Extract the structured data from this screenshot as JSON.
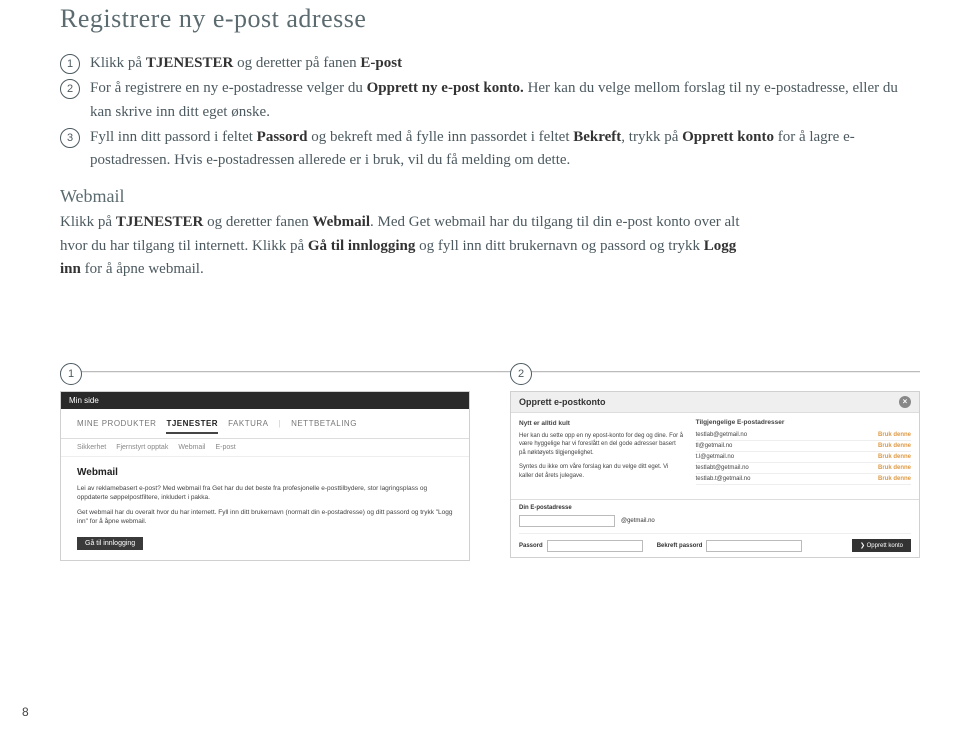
{
  "heading": "Registrere ny e-post adresse",
  "steps": [
    {
      "pre": "Klikk på ",
      "b1": "TJENESTER",
      "mid": " og deretter på fanen ",
      "b2": "E-post"
    },
    {
      "pre": "For å registrere en ny e-postadresse velger du ",
      "b1": "Opprett ny e-post konto.",
      "mid": " Her kan du velge mellom forslag til ny e-postadresse, eller du kan skrive inn ditt eget ønske."
    },
    {
      "pre": "Fyll inn ditt passord i feltet ",
      "b1": "Passord",
      "mid": " og bekreft med å fylle inn passordet i feltet ",
      "b2": "Bekreft",
      "mid2": ", trykk på ",
      "b3": "Opprett konto",
      "mid3": " for å lagre e-postadressen. Hvis e-postadressen allerede er i bruk, vil du få melding om dette."
    }
  ],
  "webmail": {
    "title": "Webmail",
    "p1a": "Klikk på ",
    "p1b": "TJENESTER",
    "p1c": " og deretter fanen ",
    "p1d": "Webmail",
    "p1e": ". Med Get webmail har du tilgang til din e-post konto over alt hvor du har tilgang til internett. Klikk på ",
    "p1f": "Gå til innlogging",
    "p1g": " og fyll inn ditt bruker­navn og passord og trykk ",
    "p1h": "Logg inn",
    "p1i": " for å åpne webmail."
  },
  "fig1": {
    "num": "1",
    "top": "Min side",
    "tabs": [
      "MINE PRODUKTER",
      "TJENESTER",
      "FAKTURA",
      "NETTBETALING"
    ],
    "subtabs": [
      "Sikkerhet",
      "Fjernstyrt opptak",
      "Webmail",
      "E-post"
    ],
    "h": "Webmail",
    "p1": "Lei av reklamebasert e-post? Med webmail fra Get har du det beste fra profesjonelle e-posttilbydere, stor lagringsplass og oppdaterte søppelpostfiltere, inkludert i pakka.",
    "p2": "Get webmail har du overalt hvor du har internett. Fyll inn ditt brukernavn (normalt din e-postadresse) og ditt passord og trykk \"Logg inn\" for å åpne webmail.",
    "link": "Gå til innlogging"
  },
  "fig2": {
    "num": "2",
    "title": "Opprett e-postkonto",
    "introH": "Nytt er alltid kult",
    "intro1": "Her kan du sette opp en ny epost-konto for deg og dine. For å være hyggelige har vi foreslått en del gode adresser basert på nøktøyets tilgjengelighet.",
    "intro2": "Syntes du ikke om våre forslag kan du velge ditt eget. Vi kaller det årets julegave.",
    "suggestH": "Tilgjengelige E-postadresser",
    "suggestions": [
      "testlab@getmail.no",
      "tl@getmail.no",
      "t.l@getmail.no",
      "testlabt@getmail.no",
      "testlab.t@getmail.no"
    ],
    "del": "Bruk denne",
    "yourH": "Din E-postadresse",
    "domain": "@getmail.no",
    "pw": "Passord",
    "pw2": "Bekreft passord",
    "create": "Opprett konto"
  },
  "pagenum": "8"
}
